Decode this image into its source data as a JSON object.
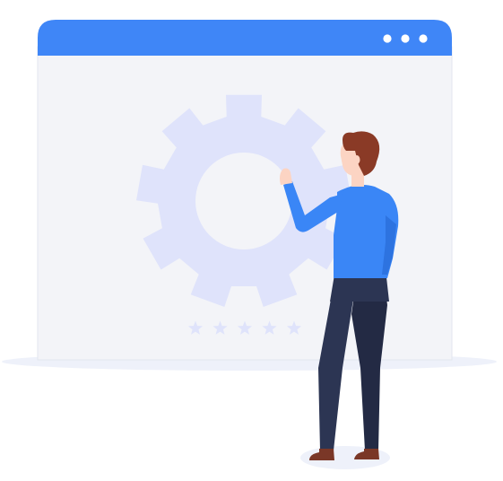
{
  "illustration": {
    "subject": "settings-maintenance",
    "rating": {
      "value": 5,
      "max": 5
    },
    "window_dot_count": 3,
    "icons": {
      "window": "browser-window-icon",
      "gear": "gear-icon",
      "star": "star-icon",
      "person": "person-figure"
    }
  },
  "colors": {
    "background": "#ffffff",
    "window_bar": "#3f86f7",
    "window_body": "#f3f4f8",
    "window_border": "#e3e6ef",
    "window_dots": "#ffffff",
    "floor_shadow": "#eef1fa",
    "gear": "#dfe3fb",
    "stars": "#dfe3fb",
    "shirt": "#3a86f6",
    "shirt_shade": "#2d73e0",
    "pants": "#2c3553",
    "pants_shade": "#232a44",
    "hair": "#8a3a26",
    "skin": "#fcd4c3",
    "shoes": "#7a3727",
    "feet_shadow": "#eef1fa"
  }
}
